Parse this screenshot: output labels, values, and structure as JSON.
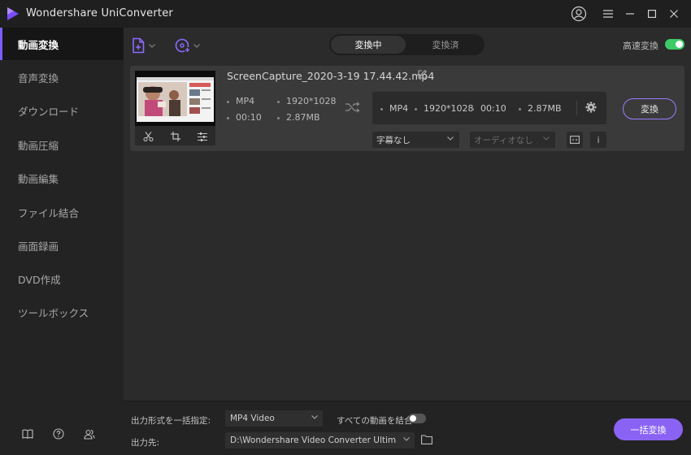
{
  "window": {
    "title": "Wondershare UniConverter"
  },
  "sidebar": {
    "items": [
      {
        "label": "動画変換",
        "active": true
      },
      {
        "label": "音声変換",
        "active": false
      },
      {
        "label": "ダウンロード",
        "active": false
      },
      {
        "label": "動画圧縮",
        "active": false
      },
      {
        "label": "動画編集",
        "active": false
      },
      {
        "label": "ファイル結合",
        "active": false
      },
      {
        "label": "画面録画",
        "active": false
      },
      {
        "label": "DVD作成",
        "active": false
      },
      {
        "label": "ツールボックス",
        "active": false
      }
    ],
    "bottom_icons": [
      "book-icon",
      "help-icon",
      "users-icon"
    ]
  },
  "toolbar": {
    "add_file_icon": "add-file-icon",
    "add_disc_icon": "add-disc-icon",
    "tabs": [
      {
        "label": "変換中",
        "active": true
      },
      {
        "label": "変換済",
        "active": false
      }
    ],
    "fast_convert_label": "高速変換",
    "fast_convert_on": true
  },
  "file": {
    "name": "ScreenCapture_2020-3-19 17.44.42.mp4",
    "source": {
      "format": "MP4",
      "resolution": "1920*1028",
      "duration": "00:10",
      "size": "2.87MB"
    },
    "target": {
      "format": "MP4",
      "resolution": "1920*1028",
      "duration": "00:10",
      "size": "2.87MB"
    },
    "subtitle_select": "字幕なし",
    "audio_select": "オーディオなし",
    "convert_label": "変換",
    "info_label": "i"
  },
  "bottom": {
    "output_format_label": "出力形式を一括指定:",
    "output_format_value": "MP4 Video",
    "merge_label": "すべての動画を結合",
    "merge_on": false,
    "output_path_label": "出力先:",
    "output_path_value": "D:\\Wondershare Video Converter Ultimate\\Co",
    "batch_convert_label": "一括変換"
  },
  "colors": {
    "accent": "#8a63f5",
    "toggle_on": "#3ecb66",
    "sidebar_active_bar": "#7c5cff"
  }
}
